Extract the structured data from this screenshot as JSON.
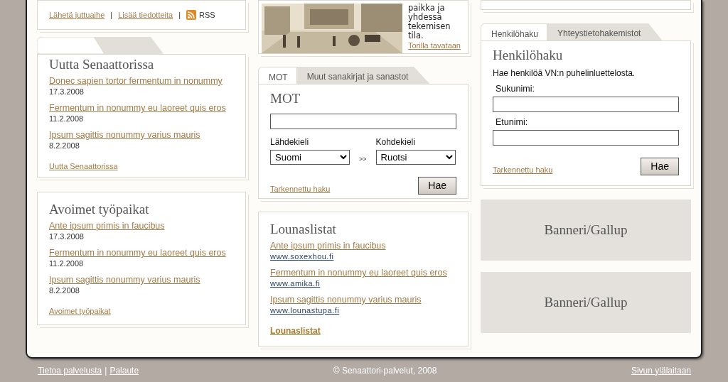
{
  "top_left": {
    "links": [
      {
        "label": "Lähetä juttuaihe"
      },
      {
        "label": "Lisää tiedotteita"
      }
    ],
    "separator": "|",
    "rss_label": "RSS"
  },
  "feature": {
    "text": "paikka ja yhdessä tekemisen tila.",
    "link": "Torilla tavataan"
  },
  "news": {
    "title": "Uutta Senaattorissa",
    "items": [
      {
        "title": "Donec sapien tortor fermentum in nonummy",
        "date": "17.3.2008"
      },
      {
        "title": "Fermentum in nonummy eu laoreet quis eros",
        "date": "11.2.2008"
      },
      {
        "title": "Ipsum sagittis nonummy varius mauris",
        "date": "8.2.2008"
      }
    ],
    "more": "Uutta Senaattorissa"
  },
  "jobs": {
    "title": "Avoimet työpaikat",
    "items": [
      {
        "title": "Ante ipsum primis in faucibus",
        "date": "17.3.2008"
      },
      {
        "title": "Fermentum in nonummy eu laoreet quis eros",
        "date": "11.2.2008"
      },
      {
        "title": "Ipsum sagittis nonummy varius mauris",
        "date": "8.2.2008"
      }
    ],
    "more": "Avoimet työpaikat"
  },
  "dictionary": {
    "tabs": [
      {
        "label": "MOT",
        "selected": true
      },
      {
        "label": "Muut sanakirjat ja sanastot",
        "selected": false
      }
    ],
    "title": "MOT",
    "source_label": "Lähdekieli",
    "source_value": "Suomi",
    "separator": ">>",
    "target_label": "Kohdekieli",
    "target_value": "Ruotsi",
    "advanced": "Tarkennettu haku",
    "button": "Hae"
  },
  "lunch": {
    "title": "Lounaslistat",
    "items": [
      {
        "title": "Ante ipsum primis in faucibus",
        "url": "www.soxexhou.fi"
      },
      {
        "title": "Fermentum in nonummy eu laoreet quis eros",
        "url": "www.amika.fi"
      },
      {
        "title": "Ipsum sagittis nonummy varius mauris",
        "url": "www.lounastupa.fi"
      }
    ],
    "more": "Lounaslistat"
  },
  "people": {
    "tabs": [
      {
        "label": "Henkilöhaku",
        "selected": true
      },
      {
        "label": "Yhteystietohakemistot",
        "selected": false
      }
    ],
    "title": "Henkilöhaku",
    "description": "Hae henkilöä VN:n puhelinluettelosta.",
    "fields": [
      {
        "label": "Sukunimi:"
      },
      {
        "label": "Etunimi:"
      }
    ],
    "advanced": "Tarkennettu haku",
    "button": "Hae"
  },
  "banners": [
    {
      "label": "Banneri/Gallup"
    },
    {
      "label": "Banneri/Gallup"
    }
  ],
  "footer": {
    "links": [
      {
        "label": "Tietoa palvelusta"
      },
      {
        "label": "Palaute"
      }
    ],
    "separator": "|",
    "copyright": "© Senaattori-palvelut, 2008",
    "top_link": "Sivun ylälaitaan"
  }
}
